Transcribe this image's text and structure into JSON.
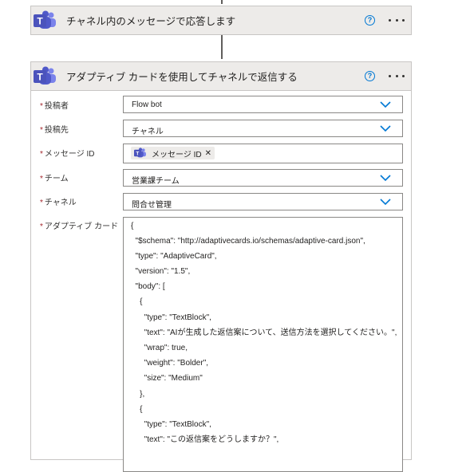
{
  "step1": {
    "title": "チャネル内のメッセージで応答します",
    "help_icon": "?"
  },
  "step2": {
    "title": "アダプティブ カードを使用してチャネルで返信する",
    "help_icon": "?"
  },
  "fields": {
    "required_mark": "*",
    "poster": {
      "label": "投稿者",
      "value": "Flow bot"
    },
    "post_in": {
      "label": "投稿先",
      "value": "チャネル"
    },
    "message_id": {
      "label": "メッセージ ID",
      "token": "メッセージ ID",
      "remove": "✕"
    },
    "team": {
      "label": "チーム",
      "value": "営業課チーム"
    },
    "channel": {
      "label": "チャネル",
      "value": "問合せ管理"
    },
    "adaptive_card": {
      "label": "アダプティブ カード"
    }
  },
  "json_lines": [
    "{",
    "  \"$schema\": \"http://adaptivecards.io/schemas/adaptive-card.json\",",
    "  \"type\": \"AdaptiveCard\",",
    "  \"version\": \"1.5\",",
    "  \"body\": [",
    "    {",
    "      \"type\": \"TextBlock\",",
    "      \"text\": \"AIが生成した返信案について、送信方法を選択してください。\",",
    "      \"wrap\": true,",
    "      \"weight\": \"Bolder\",",
    "      \"size\": \"Medium\"",
    "    },",
    "    {",
    "      \"type\": \"TextBlock\",",
    "      \"text\": \"この返信案をどうしますか？\","
  ],
  "colors": {
    "accent": "#0078d4",
    "teams_purple": "#5059c9",
    "required": "#a4262c"
  },
  "icons": {
    "app": "microsoft-teams-icon",
    "help": "help-circle-icon",
    "more": "more-options-icon",
    "dropdown": "chevron-down-icon"
  }
}
